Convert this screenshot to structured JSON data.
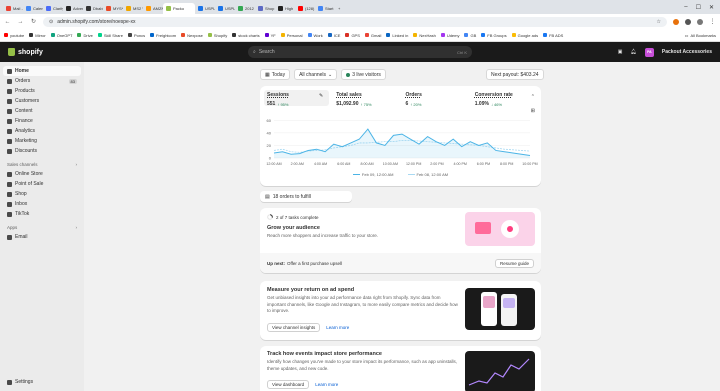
{
  "browser": {
    "tabs": [
      {
        "label": "Mail -",
        "color": "#ea4335"
      },
      {
        "label": "Calenc",
        "color": "#4285f4"
      },
      {
        "label": "Clarity",
        "color": "#4a6cf7"
      },
      {
        "label": "Advert",
        "color": "#222222"
      },
      {
        "label": "Dbabi",
        "color": "#333333"
      },
      {
        "label": "MYS*",
        "color": "#e84a27"
      },
      {
        "label": "MS2 V",
        "color": "#f0a500"
      },
      {
        "label": "AMZN",
        "color": "#ff9900"
      },
      {
        "label": "Packo",
        "color": "#95bf47",
        "active": true
      },
      {
        "label": "USPL",
        "color": "#1a73e8"
      },
      {
        "label": "USPL",
        "color": "#1a73e8"
      },
      {
        "label": "2012",
        "color": "#34a853"
      },
      {
        "label": "Shop",
        "color": "#5c6ac4"
      },
      {
        "label": "High",
        "color": "#222222"
      },
      {
        "label": "(128)",
        "color": "#ff0000"
      },
      {
        "label": "Start",
        "color": "#4285f4"
      }
    ],
    "url": "admin.shopify.com/store/noespe-xx",
    "bookmarks": [
      {
        "label": "youtube",
        "color": "#ff0000"
      },
      {
        "label": "Mirror",
        "color": "#333333"
      },
      {
        "label": "OneGPT",
        "color": "#10a37f"
      },
      {
        "label": "Drive",
        "color": "#34a853"
      },
      {
        "label": "Skill Share",
        "color": "#00d38b"
      },
      {
        "label": "Poncs",
        "color": "#444444"
      },
      {
        "label": "Freightcom",
        "color": "#0066cc"
      },
      {
        "label": "Nexpose",
        "color": "#e84a27"
      },
      {
        "label": "Shopify",
        "color": "#95bf47"
      },
      {
        "label": "stock charts",
        "color": "#333333"
      },
      {
        "label": "YF",
        "color": "#6001d2"
      },
      {
        "label": "Personal",
        "color": "#f4b400"
      },
      {
        "label": "Work",
        "color": "#4285f4"
      },
      {
        "label": "ICE",
        "color": "#1565c0"
      },
      {
        "label": "GPS",
        "color": "#d93025"
      },
      {
        "label": "Gmail",
        "color": "#ea4335"
      },
      {
        "label": "Linked in",
        "color": "#0a66c2"
      },
      {
        "label": "NexHash",
        "color": "#f4b400"
      },
      {
        "label": "Udemy",
        "color": "#a435f0"
      },
      {
        "label": "GB",
        "color": "#4285f4"
      },
      {
        "label": "FB Groups",
        "color": "#1877f2"
      },
      {
        "label": "Google ads",
        "color": "#fbbc04"
      },
      {
        "label": "FB ADS",
        "color": "#1877f2"
      }
    ],
    "all_bookmarks": "All Bookmarks"
  },
  "shopify": {
    "brand": "shopify",
    "search_placeholder": "Search",
    "search_shortcut": "Ctrl  K",
    "store_initials": "PA",
    "store_name": "Packout Accessories"
  },
  "sidebar": {
    "items": [
      {
        "label": "Home",
        "active": true
      },
      {
        "label": "Orders",
        "count": "83"
      },
      {
        "label": "Products"
      },
      {
        "label": "Customers"
      },
      {
        "label": "Content"
      },
      {
        "label": "Finance"
      },
      {
        "label": "Analytics"
      },
      {
        "label": "Marketing"
      },
      {
        "label": "Discounts"
      }
    ],
    "sales_channels_label": "Sales channels",
    "sales_channels": [
      {
        "label": "Online Store"
      },
      {
        "label": "Point of Sale"
      },
      {
        "label": "Shop"
      },
      {
        "label": "Inbox"
      },
      {
        "label": "TikTok"
      }
    ],
    "apps_label": "Apps",
    "apps": [
      {
        "label": "Email"
      }
    ],
    "settings_label": "Settings"
  },
  "dashboard": {
    "filters": {
      "date": "Today",
      "channels": "All channels",
      "live": "3 live visitors"
    },
    "payout": "Next payout: $403.24",
    "metrics": [
      {
        "label": "Sessions",
        "value": "551",
        "change": "↑ 95%",
        "selected": true
      },
      {
        "label": "Total sales",
        "value": "$1,092.90",
        "change": "↑ 75%"
      },
      {
        "label": "Orders",
        "value": "6",
        "change": "↑ 20%"
      },
      {
        "label": "Conversion rate",
        "value": "1.09%",
        "change": "↓ 46%"
      }
    ],
    "legend": {
      "current": "Feb 09, 12:00 AM",
      "previous": "Feb 08, 12:00 AM"
    },
    "orders_to_fulfill": "18 orders to fulfill"
  },
  "chart_data": {
    "type": "line",
    "x": [
      "12:00 AM",
      "2:00 AM",
      "4:00 AM",
      "6:00 AM",
      "8:00 AM",
      "10:00 AM",
      "12:00 PM",
      "2:00 PM",
      "4:00 PM",
      "6:00 PM",
      "8:00 PM",
      "10:00 PM"
    ],
    "yticks": [
      0,
      20,
      40,
      60
    ],
    "ylim": [
      0,
      70
    ],
    "series": [
      {
        "name": "Feb 09, 12:00 AM",
        "color": "#4bb4e6",
        "values": [
          8,
          10,
          6,
          7,
          12,
          14,
          10,
          22,
          18,
          24,
          30,
          46,
          24,
          20,
          36,
          38,
          30,
          22,
          34,
          26,
          20,
          30,
          18,
          26,
          20,
          24,
          12,
          10,
          8,
          6,
          4
        ]
      },
      {
        "name": "Feb 08, 12:00 AM",
        "color": "#a8d9f2",
        "values": [
          12,
          14,
          10,
          9,
          11,
          12,
          13,
          16,
          18,
          20,
          24,
          24,
          25,
          26,
          26,
          28,
          28,
          27,
          26,
          25,
          24,
          23,
          22,
          21,
          20,
          18,
          16,
          14,
          13,
          12,
          11
        ]
      }
    ]
  },
  "setup_guide": {
    "progress": "2 of 7 tasks complete",
    "progress_fraction": 0.2857,
    "title": "Grow your audience",
    "description": "Reach more shoppers and increase traffic to your store.",
    "up_next": "Up next:",
    "up_next_task": "Offer a first purchase upsell",
    "resume": "Resume guide"
  },
  "ad_card": {
    "title": "Measure your return on ad spend",
    "description": "Get unbiased insights into your ad performance data right from Shopify. Sync data from important channels, like Google and Instagram, to more easily compare metrics and decide how to improve.",
    "primary": "View channel insights",
    "secondary": "Learn more"
  },
  "events_card": {
    "title": "Track how events impact store performance",
    "description": "Identify how changes you've made to your store impact its performance, such as app uninstalls, theme updates, and new code.",
    "primary": "View dashboard",
    "secondary": "Learn more"
  }
}
